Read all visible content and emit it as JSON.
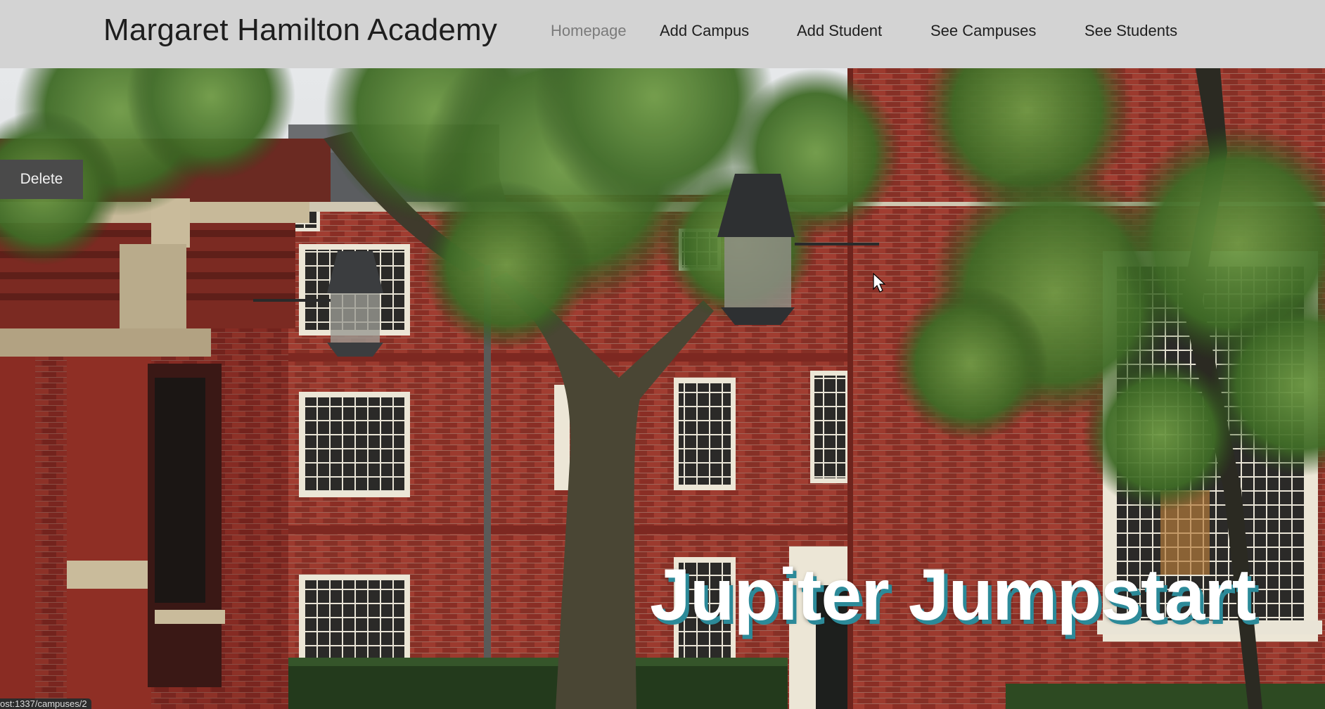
{
  "header": {
    "brand": "Margaret Hamilton Academy",
    "nav": {
      "homepage": "Homepage",
      "add_campus": "Add Campus",
      "add_student": "Add Student",
      "see_campuses": "See Campuses",
      "see_students": "See Students"
    }
  },
  "campus": {
    "delete_label": "Delete",
    "name": "Jupiter Jumpstart",
    "image_description_icon": "campus-building-photo"
  },
  "status_bar": {
    "url": "ost:1337/campuses/2"
  },
  "colors": {
    "navbar_bg": "#d3d3d3",
    "brick": "#8e2f26",
    "title_shadow": "#2c8a99",
    "delete_bg": "#4a4a4a"
  }
}
